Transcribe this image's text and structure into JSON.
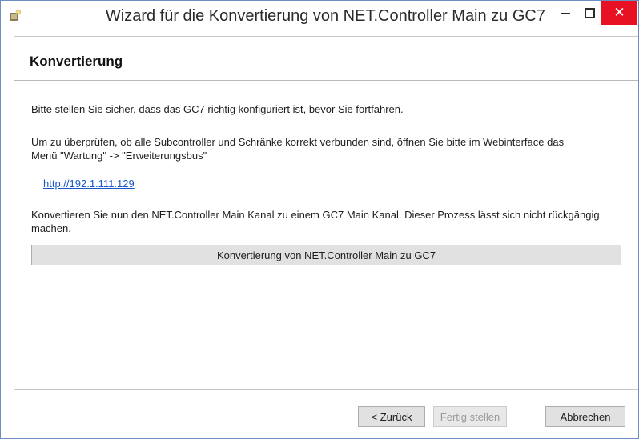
{
  "window": {
    "title": "Wizard für die Konvertierung von NET.Controller Main zu GC7",
    "icon": "wizard-app-icon",
    "controls": {
      "minimize": "minimize-icon",
      "maximize": "maximize-icon",
      "close": "✕"
    }
  },
  "page": {
    "title": "Konvertierung",
    "para1": "Bitte stellen Sie sicher, dass das GC7 richtig konfiguriert ist, bevor Sie fortfahren.",
    "para2": "Um zu überprüfen, ob alle Subcontroller und Schränke korrekt verbunden sind, öffnen Sie bitte im Webinterface das Menü \"Wartung\" -> \"Erweiterungsbus\"",
    "link": "http://192.1.111.129",
    "para3": "Konvertieren Sie nun den NET.Controller Main Kanal zu einem GC7 Main Kanal. Dieser Prozess lässt sich nicht rückgängig machen.",
    "convert_button": "Konvertierung von NET.Controller Main zu GC7"
  },
  "footer": {
    "back": "< Zurück",
    "finish": "Fertig stellen",
    "cancel": "Abbrechen"
  },
  "colors": {
    "close_button": "#e81123",
    "link": "#1a57c9",
    "disabled_text": "#9a9a9a"
  }
}
